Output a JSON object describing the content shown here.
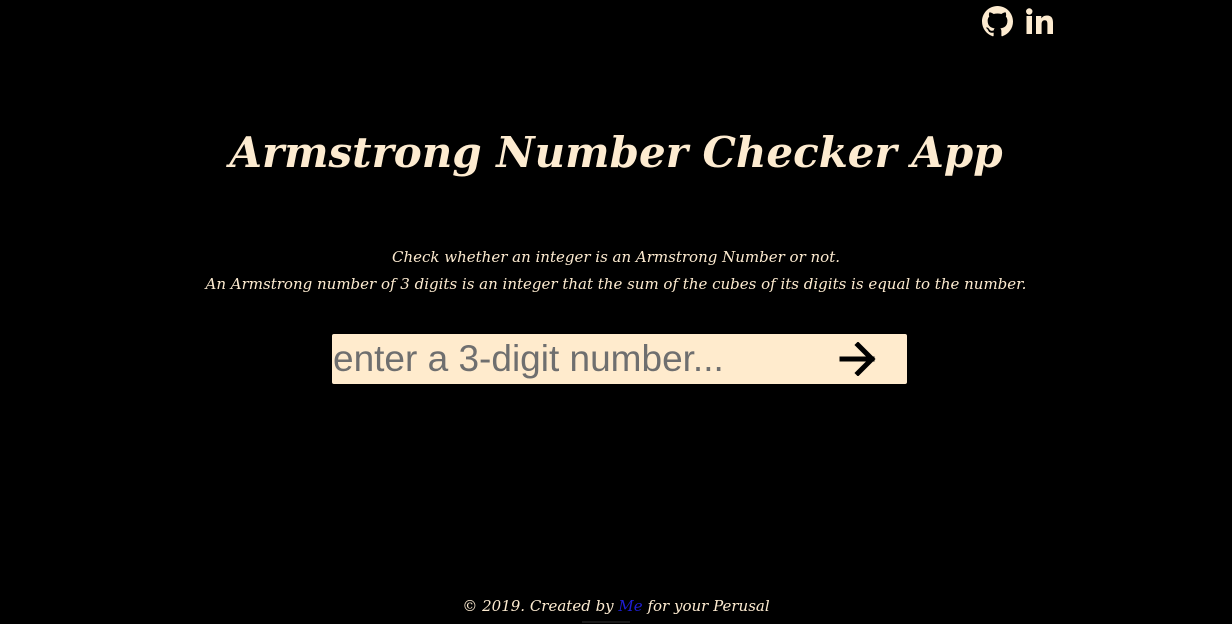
{
  "social": {
    "github_icon": "github-icon",
    "linkedin_icon": "linkedin-icon",
    "icon_color": "#fdebd0"
  },
  "header": {
    "title": "Armstrong Number Checker App"
  },
  "description": {
    "line1": "Check whether an integer is an Armstrong Number or not.",
    "line2": "An Armstrong number of 3 digits is an integer that the sum of the cubes of its digits is equal to the number."
  },
  "form": {
    "value": "",
    "placeholder": "enter a 3-digit number...",
    "submit_icon": "arrow-right-icon",
    "background": "#ffebcd"
  },
  "footer": {
    "prefix": "© 2019. Created by",
    "link_text": "Me",
    "suffix": "for your Perusal",
    "link_color": "#1f1fd6"
  }
}
